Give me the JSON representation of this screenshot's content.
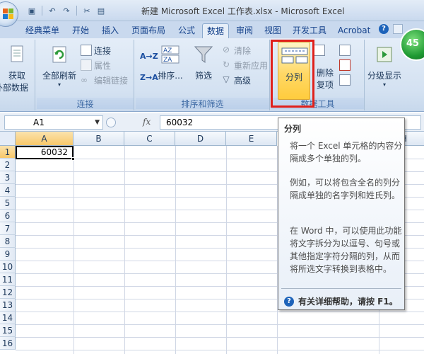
{
  "window": {
    "title": "新建 Microsoft Excel 工作表.xlsx - Microsoft Excel"
  },
  "quick_access": [
    {
      "icon": "save-icon",
      "glyph": "▣"
    },
    {
      "icon": "undo-icon",
      "glyph": "↶"
    },
    {
      "icon": "redo-icon",
      "glyph": "↷"
    },
    {
      "icon": "format-painter-icon",
      "glyph": "✂"
    },
    {
      "icon": "paste-icon",
      "glyph": "▤"
    }
  ],
  "tabs": [
    "经典菜单",
    "开始",
    "插入",
    "页面布局",
    "公式",
    "数据",
    "审阅",
    "视图",
    "开发工具",
    "Acrobat"
  ],
  "active_tab": "数据",
  "status_badge": "45",
  "ribbon": {
    "get_external": {
      "line1": "获取",
      "line2": "外部数据"
    },
    "connections": {
      "refresh_all": "全部刷新",
      "connections": "连接",
      "properties": "属性",
      "edit_links": "编辑链接",
      "group_label": "连接"
    },
    "sort_filter": {
      "sort_az": "A→Z",
      "sort_za": "Z→A",
      "sort": "排序...",
      "filter": "筛选",
      "clear": "清除",
      "reapply": "重新应用",
      "advanced": "高级",
      "group_label": "排序和筛选"
    },
    "data_tools": {
      "text_to_columns": "分列",
      "remove_duplicates_line1": "删除",
      "remove_duplicates_line2": "复项",
      "group_label": "数据工具"
    },
    "outline": {
      "label": "分级显示"
    }
  },
  "formula_bar": {
    "name_box": "A1",
    "fx": "fx",
    "value": "60032"
  },
  "grid": {
    "columns": [
      "A",
      "B",
      "C",
      "D",
      "E",
      "H"
    ],
    "rows": [
      "1",
      "2",
      "3",
      "4",
      "5",
      "6",
      "7",
      "8",
      "9",
      "10",
      "11",
      "12",
      "13",
      "14",
      "15",
      "16"
    ],
    "cells": {
      "A1": "60032"
    }
  },
  "tooltip": {
    "title": "分列",
    "para1": "将一个 Excel 单元格的内容分隔成多个单独的列。",
    "para2": "例如，可以将包含全名的列分隔成单独的名字列和姓氏列。",
    "para3": "在 Word 中，可以使用此功能将文字拆分为以逗号、句号或其他指定字符分隔的列，从而将所选文字转换到表格中。",
    "help": "有关详细帮助，请按 F1。"
  }
}
